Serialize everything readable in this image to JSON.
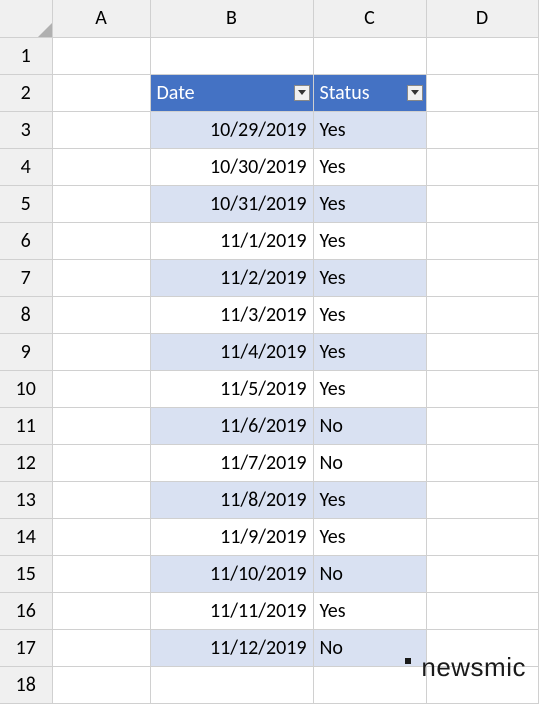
{
  "columns": [
    "A",
    "B",
    "C",
    "D"
  ],
  "row_numbers": [
    "1",
    "2",
    "3",
    "4",
    "5",
    "6",
    "7",
    "8",
    "9",
    "10",
    "11",
    "12",
    "13",
    "14",
    "15",
    "16",
    "17",
    "18"
  ],
  "header": {
    "date_label": "Date",
    "status_label": "Status"
  },
  "rows": [
    {
      "date": "10/29/2019",
      "status": "Yes"
    },
    {
      "date": "10/30/2019",
      "status": "Yes"
    },
    {
      "date": "10/31/2019",
      "status": "Yes"
    },
    {
      "date": "11/1/2019",
      "status": "Yes"
    },
    {
      "date": "11/2/2019",
      "status": "Yes"
    },
    {
      "date": "11/3/2019",
      "status": "Yes"
    },
    {
      "date": "11/4/2019",
      "status": "Yes"
    },
    {
      "date": "11/5/2019",
      "status": "Yes"
    },
    {
      "date": "11/6/2019",
      "status": "No"
    },
    {
      "date": "11/7/2019",
      "status": "No"
    },
    {
      "date": "11/8/2019",
      "status": "Yes"
    },
    {
      "date": "11/9/2019",
      "status": "Yes"
    },
    {
      "date": "11/10/2019",
      "status": "No"
    },
    {
      "date": "11/11/2019",
      "status": "Yes"
    },
    {
      "date": "11/12/2019",
      "status": "No"
    }
  ],
  "watermark": "newsmic"
}
